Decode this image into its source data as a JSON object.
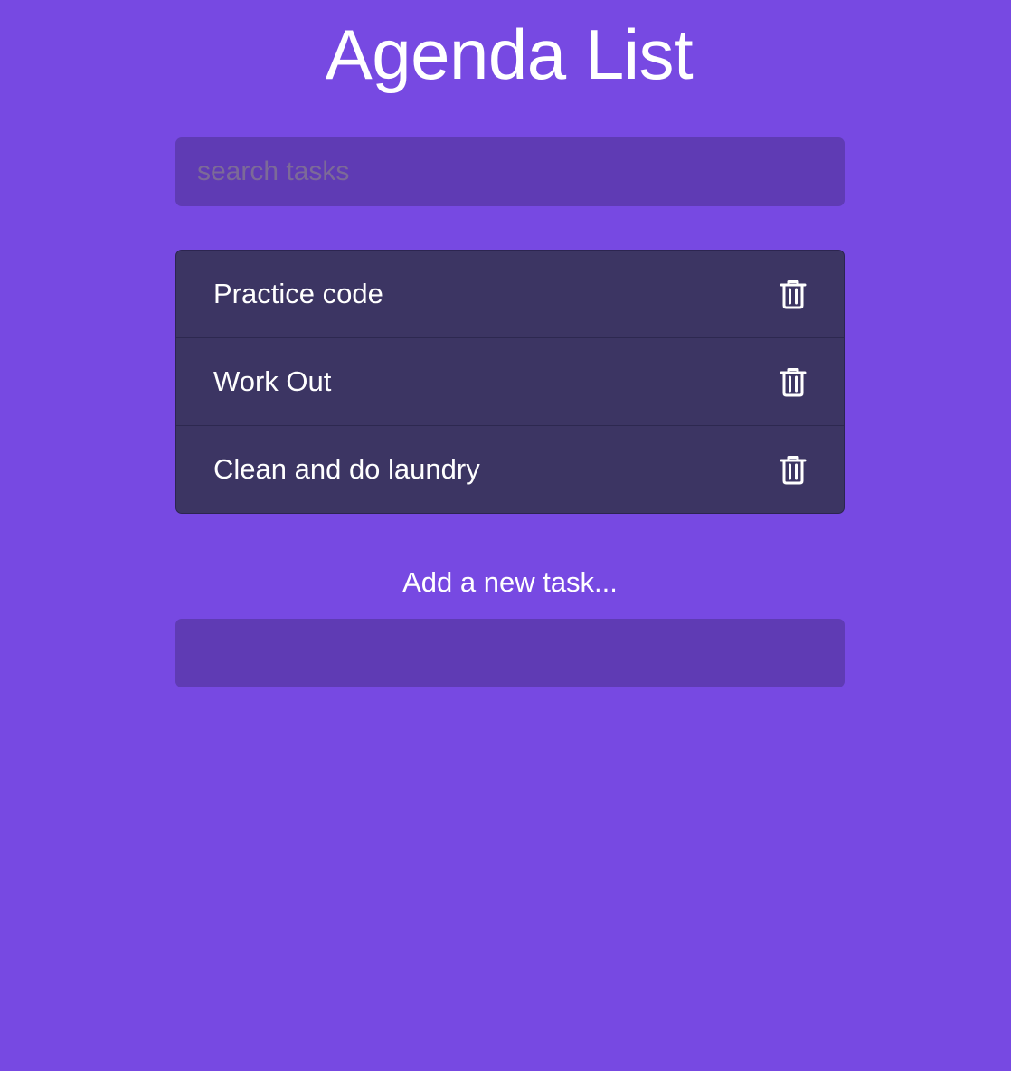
{
  "app": {
    "title": "Agenda List"
  },
  "search": {
    "placeholder": "search tasks",
    "value": ""
  },
  "tasks": [
    {
      "label": "Practice code",
      "action_icon": "trash-icon"
    },
    {
      "label": "Work Out",
      "action_icon": "trash-icon"
    },
    {
      "label": "Clean and do laundry",
      "action_icon": "trash-icon"
    }
  ],
  "add_task": {
    "label": "Add a new task...",
    "value": ""
  },
  "colors": {
    "background": "#7749e2",
    "input_background": "#5f3bb4",
    "list_background": "#3c3563",
    "text": "#ffffff",
    "placeholder": "#7c6a98"
  }
}
